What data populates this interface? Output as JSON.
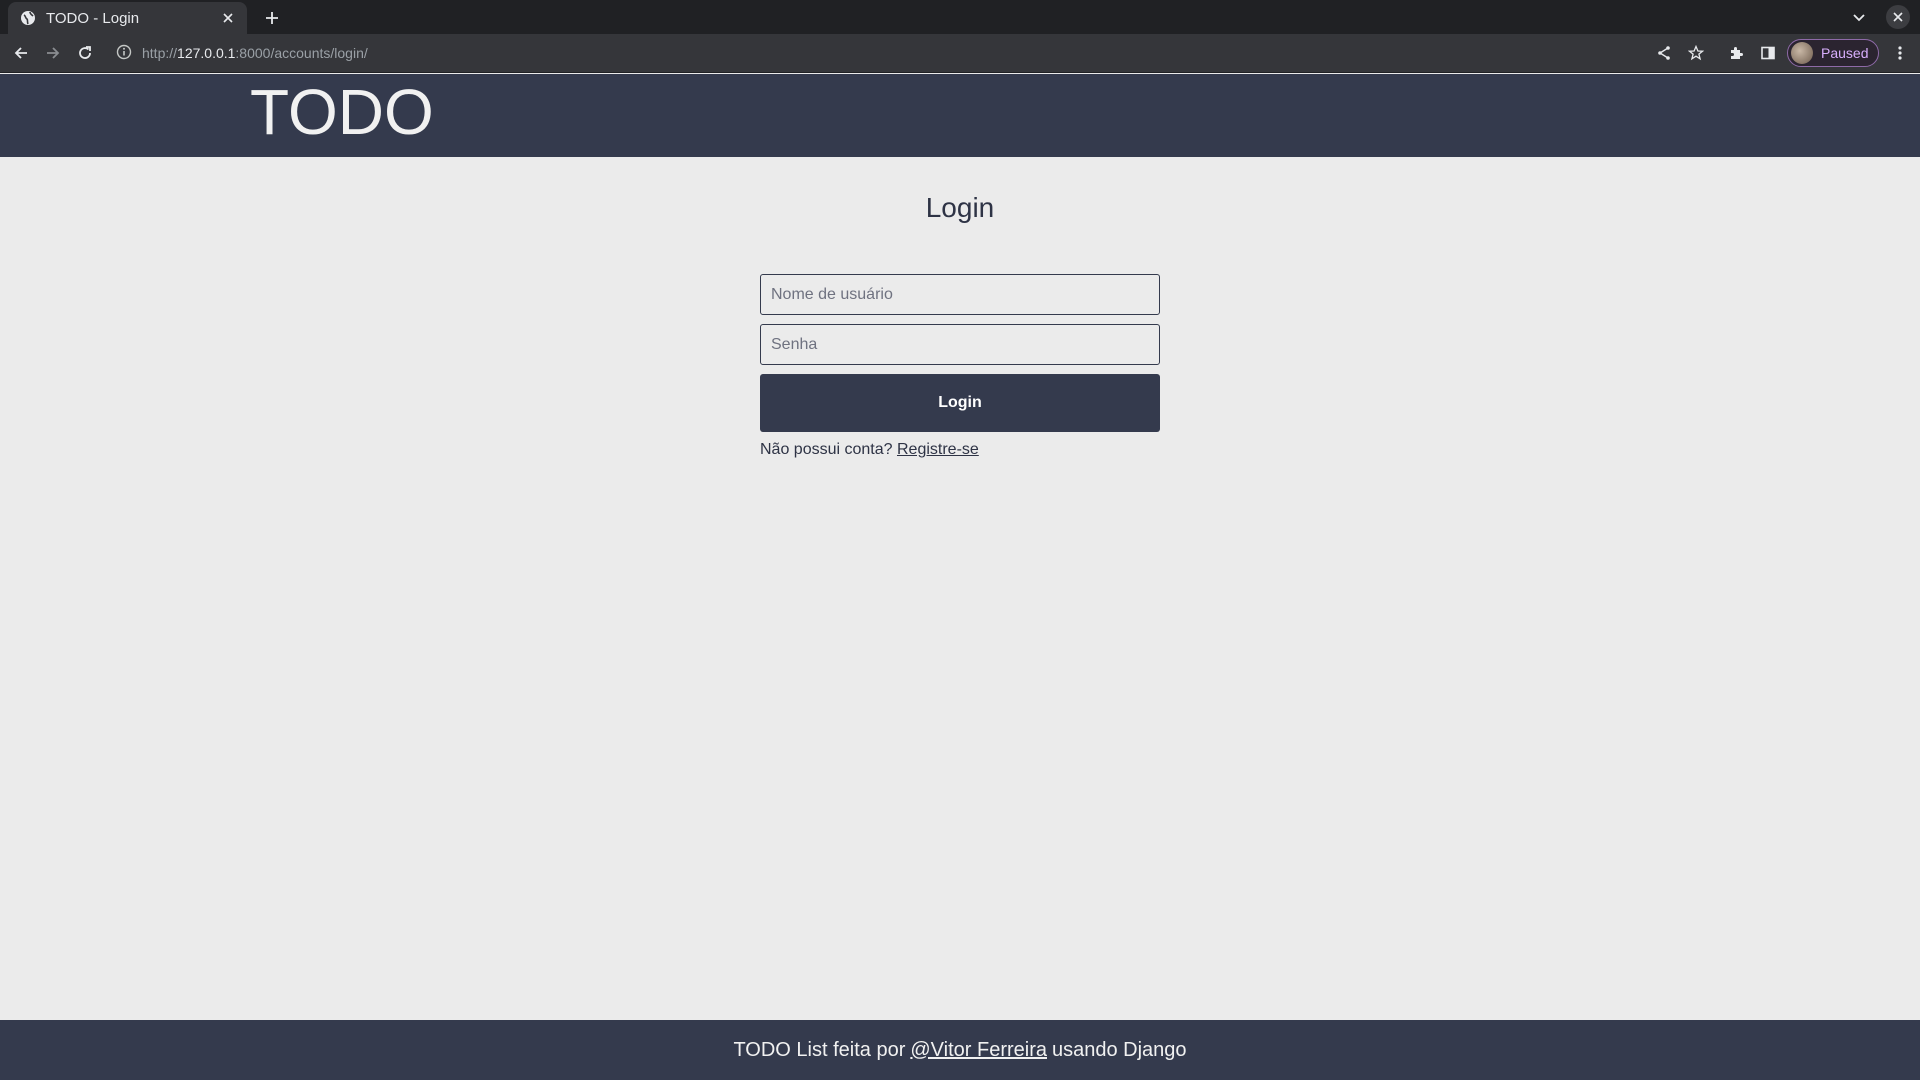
{
  "browser": {
    "tab": {
      "title": "TODO - Login",
      "favicon": "globe-icon"
    },
    "url": {
      "scheme": "http://",
      "host": "127.0.0.1",
      "rest": ":8000/accounts/login/"
    },
    "profile": {
      "status": "Paused"
    },
    "icons": {
      "back": "arrow-left-icon",
      "forward": "arrow-right-icon",
      "reload": "reload-icon",
      "site_info": "info-icon",
      "share": "share-icon",
      "bookmark": "star-icon",
      "extensions": "puzzle-icon",
      "side_panel": "side-panel-icon",
      "menu": "kebab-menu-icon",
      "new_tab": "plus-icon",
      "tab_search": "chevron-down-icon",
      "close_window": "close-icon"
    }
  },
  "header": {
    "brand": "TODO"
  },
  "login": {
    "title": "Login",
    "username_placeholder": "Nome de usuário",
    "username_value": "",
    "password_placeholder": "Senha",
    "password_value": "",
    "submit_label": "Login",
    "signup_prompt": "Não possui conta?",
    "signup_link": "Registre-se"
  },
  "footer": {
    "prefix": "TODO List feita por",
    "author_link": "@Vitor Ferreira",
    "suffix": "usando Django"
  },
  "colors": {
    "header_bg": "#343a4d",
    "page_bg": "#ebebeb",
    "button_bg": "#343a4d",
    "text_dark": "#2e3345",
    "chip_text": "#d7aefb"
  }
}
